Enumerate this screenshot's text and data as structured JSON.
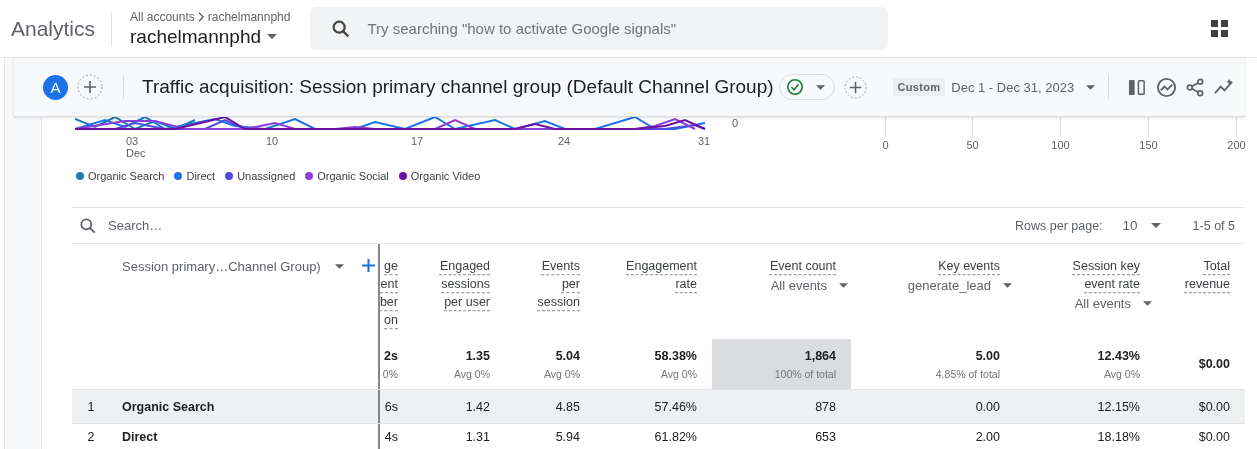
{
  "header": {
    "app_name": "Analytics",
    "breadcrumb": [
      "All accounts",
      "rachelmannphd"
    ],
    "account": "rachelmannphd",
    "search": {
      "placeholder": "Try searching \"how to activate Google signals\""
    }
  },
  "report": {
    "avatar": "A",
    "title": "Traffic acquisition: Session primary channel group (Default Channel Group)",
    "date_chip": "Custom",
    "date_range": "Dec 1 - Dec 31, 2023"
  },
  "line_chart": {
    "x_labels": [
      {
        "day": "03",
        "month": "Dec"
      },
      {
        "day": "10"
      },
      {
        "day": "17"
      },
      {
        "day": "24"
      },
      {
        "day": "31"
      }
    ],
    "y_label": "0"
  },
  "bar_axis": {
    "ticks": [
      "0",
      "50",
      "100",
      "150",
      "200"
    ]
  },
  "legend": [
    {
      "label": "Organic Search",
      "color": "#1b7cb3"
    },
    {
      "label": "Direct",
      "color": "#1a73e8"
    },
    {
      "label": "Unassigned",
      "color": "#4e4ee6"
    },
    {
      "label": "Organic Social",
      "color": "#8a3ed8"
    },
    {
      "label": "Organic Video",
      "color": "#6f0fa0"
    }
  ],
  "table": {
    "search_placeholder": "Search…",
    "rows_per_page_label": "Rows per page:",
    "rows_per_page": "10",
    "range": "1-5 of 5",
    "dimension": "Session primary…Channel Group)",
    "columns": [
      {
        "lines": [
          "ge",
          "ent",
          "ber",
          "on"
        ],
        "total": "2s",
        "note": "0%",
        "sorted": false
      },
      {
        "lines": [
          "Engaged",
          "sessions",
          "per user"
        ],
        "total": "1.35",
        "note": "Avg 0%",
        "sorted": false
      },
      {
        "lines": [
          "Events",
          "per",
          "session"
        ],
        "total": "5.04",
        "note": "Avg 0%",
        "sorted": false
      },
      {
        "lines": [
          "Engagement",
          "rate"
        ],
        "total": "58.38%",
        "note": "Avg 0%",
        "sorted": false
      },
      {
        "lines": [
          "Event count"
        ],
        "filter": "All events",
        "total": "1,864",
        "note": "100% of total",
        "sorted": true
      },
      {
        "lines": [
          "Key events"
        ],
        "filter": "generate_lead",
        "total": "5.00",
        "note": "4.85% of total",
        "sorted": false
      },
      {
        "lines": [
          "Session key",
          "event rate"
        ],
        "filter": "All events",
        "total": "12.43%",
        "note": "Avg 0%",
        "sorted": false
      },
      {
        "lines": [
          "Total",
          "revenue"
        ],
        "total": "$0.00",
        "sorted": false
      }
    ],
    "rows": [
      {
        "rank": "1",
        "channel": "Organic Search",
        "highlighted": true,
        "values": [
          "6s",
          "1.42",
          "4.85",
          "57.46%",
          "878",
          "0.00",
          "12.15%",
          "$0.00"
        ]
      },
      {
        "rank": "2",
        "channel": "Direct",
        "highlighted": false,
        "values": [
          "4s",
          "1.31",
          "5.94",
          "61.82%",
          "653",
          "2.00",
          "18.18%",
          "$0.00"
        ]
      }
    ]
  }
}
